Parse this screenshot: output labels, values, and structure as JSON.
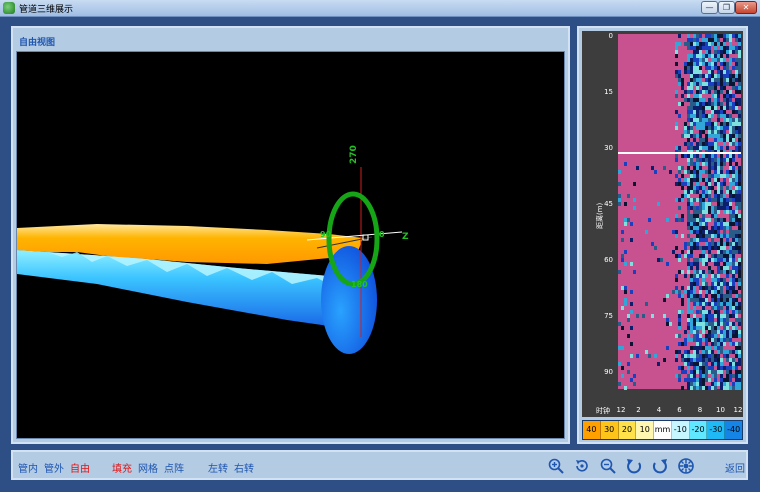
{
  "window": {
    "title": "管道三维展示",
    "min": "—",
    "max": "❐",
    "close": "✕"
  },
  "main_panel": {
    "view_label": "自由视图"
  },
  "ring": {
    "label_top": "270",
    "label_right": "0",
    "label_left": "90",
    "label_bottom": "180"
  },
  "axes": {
    "z_label": "Z"
  },
  "side_panel": {
    "y_axis_label": "距离(m)",
    "x_axis_label": "时钟",
    "y_ticks": [
      "0",
      "15",
      "30",
      "45",
      "60",
      "75",
      "90"
    ],
    "x_ticks": [
      "12",
      "2",
      "4",
      "6",
      "8",
      "10",
      "12"
    ]
  },
  "legend": [
    {
      "label": "40",
      "color": "#ff9f00"
    },
    {
      "label": "30",
      "color": "#ffc41a"
    },
    {
      "label": "20",
      "color": "#ffe24a"
    },
    {
      "label": "10",
      "color": "#fff7b0"
    },
    {
      "label": "mm",
      "color": "#ffffff"
    },
    {
      "label": "-10",
      "color": "#c6f6ff"
    },
    {
      "label": "-20",
      "color": "#5fe8ff"
    },
    {
      "label": "-30",
      "color": "#1fbaf5"
    },
    {
      "label": "-40",
      "color": "#1485e6"
    }
  ],
  "toolbar": {
    "inner": "管内",
    "outer": "管外",
    "free": "自由",
    "fill": "填充",
    "grid": "网格",
    "dots": "点阵",
    "rotate_left": "左转",
    "rotate_right": "右转",
    "back": "返回"
  },
  "icons": [
    "zoom-in-icon",
    "reset-view-icon",
    "zoom-out-icon",
    "rotate-ccw-icon",
    "rotate-cw-icon",
    "settings-icon"
  ]
}
